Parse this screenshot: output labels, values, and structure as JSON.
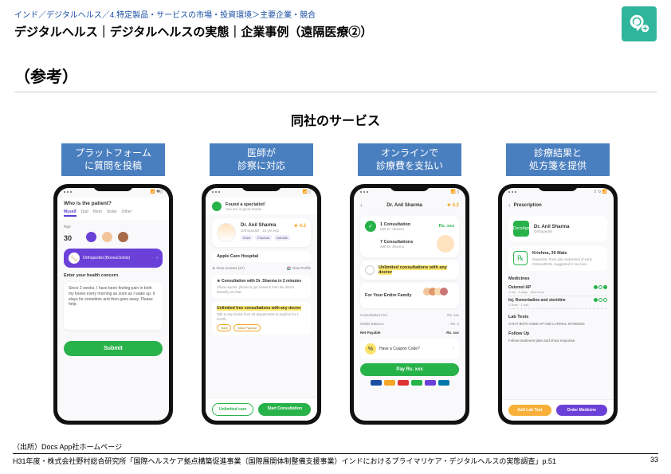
{
  "breadcrumb": "インド／デジタルヘルス／4.特定製品・サービスの市場・投資環境＞主要企業・競合",
  "title": "デジタルヘルス｜デジタルヘルスの実態｜企業事例（遠隔医療②）",
  "ref": "（参考）",
  "service_title": "同社のサービス",
  "columns": [
    {
      "label": "プラットフォーム\nに質問を投稿"
    },
    {
      "label": "医師が\n診察に対応"
    },
    {
      "label": "オンラインで\n診療費を支払い"
    },
    {
      "label": "診療結果と\n処方箋を提供"
    }
  ],
  "s1": {
    "question": "Who is the patient?",
    "tabs": [
      "Myself",
      "Dad",
      "Mom",
      "Sister",
      "Other"
    ],
    "age_label": "Age",
    "age_value": "30",
    "banner": "Orthopedist (Bones/Joints)",
    "concern_label": "Enter your health concern",
    "concern_text": "Since 2 weeks, I have been feeling pain in both my knees every morning as soon as I wake up. It stays for sometime and then goes away. Please help.",
    "submit": "Submit"
  },
  "s2": {
    "head": "Found a specialist!",
    "head_sub": "You are in good hands",
    "doc_name": "Dr. Anil Sharma",
    "doc_sub": "Orthopedist · 15 yrs exp",
    "rating": "★ 4.2",
    "chips": [
      "Knee",
      "Fracture",
      "Arthritis"
    ],
    "hospital": "Apple Care Hospital",
    "line_l": "★ View reviews (27)",
    "line_r": "🏥 View Profile",
    "block1_t": "★ Consultation with Dr. Sharma in 2 minutes",
    "block1_note": "Share reports, photos & get answers from the doctor instantly on chat.",
    "block2_t": "Unlimited free consultations with any doctor",
    "block2_note": "Talk to any doctor from 18 departments at anytime for 1 month.",
    "tags": [
      "Gold",
      "Most Popular"
    ],
    "btn_out": "Unlimited care",
    "btn_fill": "Start Consultation"
  },
  "s3": {
    "doc_name": "Dr. Anil Sharma",
    "rating": "★ 4.2",
    "t1": "1 Consultation",
    "t1s": "with Dr. Sharma",
    "p1": "Rs. xxx",
    "t2": "7 Consultations",
    "t2s": "with Dr. Sharma",
    "t3": "Unlimited consultations with any doctor",
    "fam_t": "For Your Entire Family",
    "fee_l": "Consultation Fee",
    "fee_r": "Rs. xxx",
    "bal_l": "Wallet Balance",
    "bal_r": "- Rs. 0",
    "net_l": "Net Payable",
    "net_r": "Rs. xxx",
    "coupon": "Have a Coupon Code?",
    "paybtn": "Pay Rs. xxx"
  },
  "s4": {
    "title": "Prescription",
    "doc": "DocsApp",
    "doc_name": "Dr. Anil Sharma",
    "rx_name": "Krishna, 30 Male",
    "rx_diag": "Diagnosis: Knee pain suspected of early Osteoarthritis. Suggested X-ray knee.",
    "med_sec": "Medicines",
    "med1": "Ostemol AP",
    "med1d": "1 tab · 3 days · After food",
    "med2": "Inj. Remortadine and steridine",
    "med2d": "1 dose · 1 day",
    "test_sec": "Lab Tests",
    "test1": "X-RAY BOTH KNEE AP AND LATERAL STANDING",
    "follow_sec": "Follow Up",
    "follow": "Follow treatment plan and show response",
    "btn_y": "Add Lab Test",
    "btn_p": "Order Medicine"
  },
  "source": "（出所）Docs App社ホームページ",
  "footer_left": "H31年度・株式会社野村総合研究所「国際ヘルスケア拠点構築促進事業（国際展開体制整備支援事業）インドにおけるプライマリケア・デジタルヘルスの実態調査」p.51",
  "page_number": "33"
}
